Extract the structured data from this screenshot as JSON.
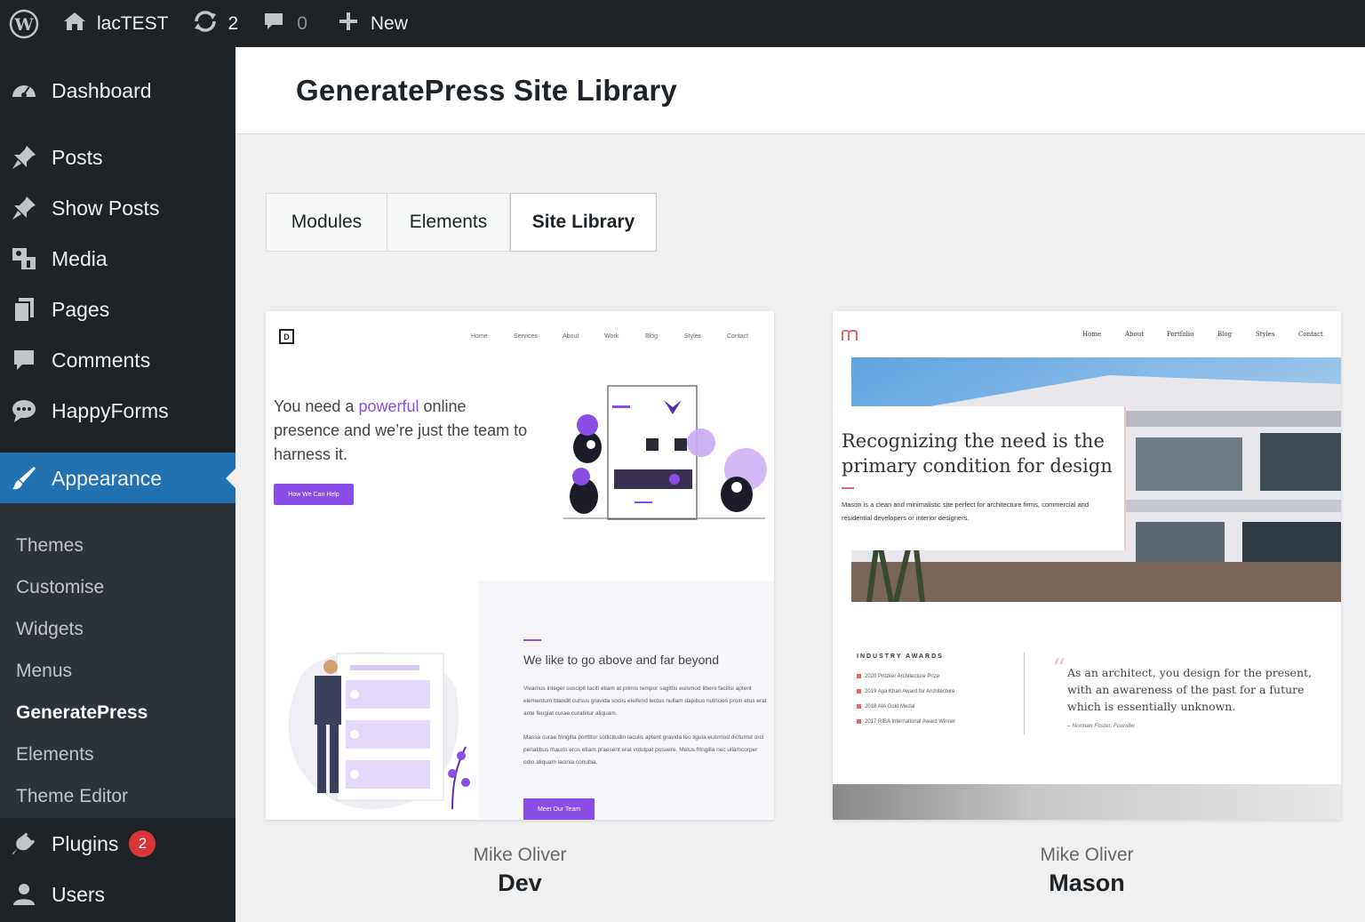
{
  "admin_bar": {
    "site_name": "lacTEST",
    "updates_count": "2",
    "comments_count": "0",
    "new_label": "New"
  },
  "sidebar": {
    "items": [
      {
        "label": "Dashboard",
        "icon": "dashboard-icon"
      },
      {
        "label": "Posts",
        "icon": "pin-icon"
      },
      {
        "label": "Show Posts",
        "icon": "pin-icon"
      },
      {
        "label": "Media",
        "icon": "media-icon"
      },
      {
        "label": "Pages",
        "icon": "pages-icon"
      },
      {
        "label": "Comments",
        "icon": "comment-icon"
      },
      {
        "label": "HappyForms",
        "icon": "chat-icon"
      },
      {
        "label": "Appearance",
        "icon": "brush-icon"
      },
      {
        "label": "Plugins",
        "icon": "plugin-icon"
      },
      {
        "label": "Users",
        "icon": "user-icon"
      }
    ],
    "submenu": [
      "Themes",
      "Customise",
      "Widgets",
      "Menus",
      "GeneratePress",
      "Elements",
      "Theme Editor"
    ],
    "plugins_badge": "2"
  },
  "page": {
    "title": "GeneratePress Site Library"
  },
  "tabs": [
    "Modules",
    "Elements",
    "Site Library"
  ],
  "sites": [
    {
      "author": "Mike Oliver",
      "name": "Dev",
      "preview": {
        "logo": "D",
        "nav": [
          "Home",
          "Services",
          "About",
          "Work",
          "Blog",
          "Styles",
          "Contact"
        ],
        "hero_pre": "You need a ",
        "hero_highlight": "powerful",
        "hero_post": " online presence and we’re just the team to harness it.",
        "button": "How We Can Help",
        "heading2": "We like to go above and far beyond",
        "para1": "Vivamus integer suscipit taciti etiam at primis tempor sagittis euismod libero facilisi aptent elementum blandit cursus gravida sociis eleifend lectus nullam dapibus nutricies proin etus erat ante feugiat curae curabitur aliquam.",
        "para2": "Massa curae fringilla porttitor sollicitudin iaculis aptent gravida leo ligula euismod dictumst orci penatibus mauris eros etiam praesent erat volutpat posuere. Metus fringilla nec ullamcorper odio aliquam lacinia conubia.",
        "button2": "Meet Our Team",
        "accent": "#8a4de6"
      }
    },
    {
      "author": "Mike Oliver",
      "name": "Mason",
      "preview": {
        "nav": [
          "Home",
          "About",
          "Portfolio",
          "Blog",
          "Styles",
          "Contact"
        ],
        "heading": "Recognizing the need is the primary condition for design",
        "para": "Mason is a clean and minimalistic site perfect for architecture firms, commercial and residential developers or interior designers.",
        "awards_title": "INDUSTRY AWARDS",
        "awards": [
          "2020 Pritzker Architecture Prize",
          "2019 Aga Khan Award for Architecture",
          "2018 AIA Gold Medal",
          "2017 RIBA International Award Winner"
        ],
        "quote": "As an architect, you design for the present, with an awareness of the past for a future which is essentially unknown.",
        "cite": "– Norman Foster, Founder",
        "accent": "#e06a6a"
      }
    }
  ]
}
